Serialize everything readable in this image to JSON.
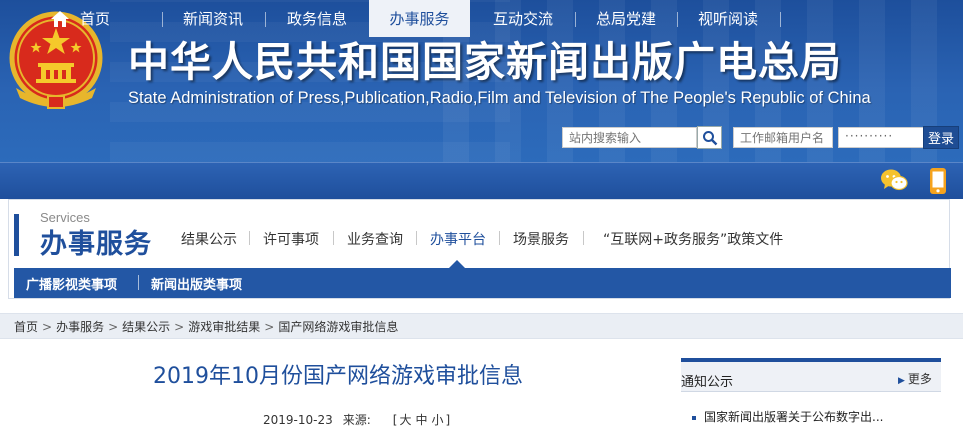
{
  "header": {
    "title_cn": "中华人民共和国国家新闻出版广电总局",
    "title_en": "State Administration of Press,Publication,Radio,Film and Television of The People's Republic of China",
    "emblem_icon": "national-emblem-icon",
    "search_placeholder": "站内搜索输入",
    "search_icon": "search-icon",
    "email_placeholder": "工作邮箱用户名",
    "password_value": "··········",
    "login_label": "登录"
  },
  "nav": {
    "items": [
      {
        "label": "首页",
        "icon": "home-icon"
      },
      {
        "label": "新闻资讯"
      },
      {
        "label": "政务信息"
      },
      {
        "label": "办事服务",
        "active": true
      },
      {
        "label": "互动交流"
      },
      {
        "label": "总局党建"
      },
      {
        "label": "视听阅读"
      }
    ],
    "wechat_icon": "wechat-icon",
    "mobile_icon": "mobile-icon"
  },
  "services": {
    "en": "Services",
    "cn": "办事服务",
    "links": [
      {
        "label": "结果公示"
      },
      {
        "label": "许可事项"
      },
      {
        "label": "业务查询"
      },
      {
        "label": "办事平台",
        "active": true
      },
      {
        "label": "场景服务"
      },
      {
        "label": "“互联网+政务服务”政策文件"
      }
    ],
    "sub_items": [
      {
        "label": "广播影视类事项"
      },
      {
        "label": "新闻出版类事项"
      }
    ]
  },
  "breadcrumb": [
    "首页",
    "办事服务",
    "结果公示",
    "游戏审批结果",
    "国产网络游戏审批信息"
  ],
  "article": {
    "title": "2019年10月份国产网络游戏审批信息",
    "date": "2019-10-23",
    "source_label": "来源:",
    "font_sizes": [
      "大",
      "中",
      "小"
    ]
  },
  "sidebar": {
    "title": "通知公示",
    "more": "更多",
    "items": [
      "国家新闻出版署关于公布数字出..."
    ]
  },
  "colors": {
    "brand_blue": "#1f4f9c",
    "nav_active_bg": "#eef2f8",
    "header_bg": "#2a63b3"
  }
}
